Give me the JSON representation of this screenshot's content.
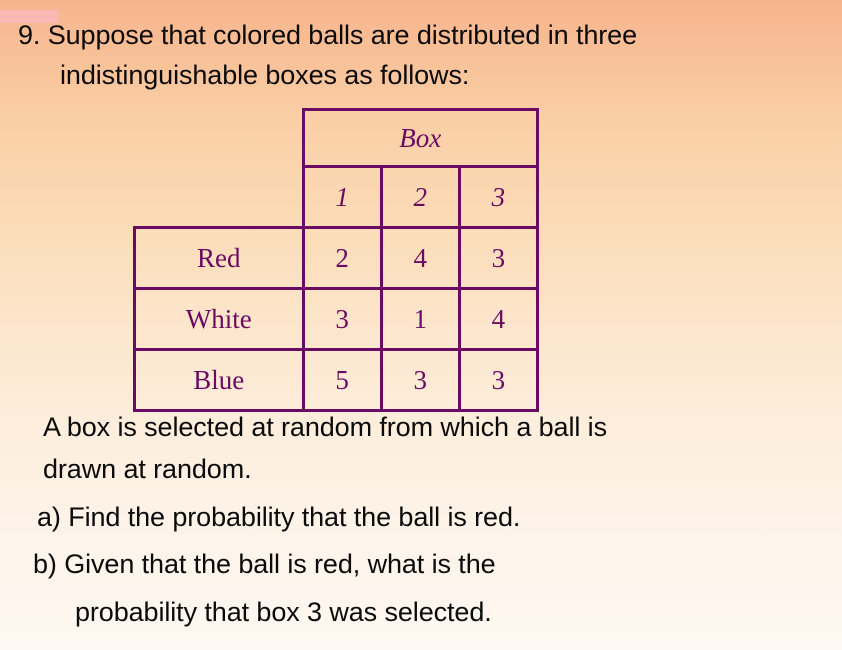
{
  "slide": {
    "background_top_color": "#F7B48C",
    "background_bottom_color": "#FEF8F2",
    "accent_color": "#6B0A62",
    "body_text_color": "#0B0B0B",
    "artifact_band_color": "#F9B8B4"
  },
  "question": {
    "line1": "9. Suppose that colored balls are distributed in three",
    "line2": "indistinguishable boxes as follows:"
  },
  "table": {
    "header_title": "Box",
    "column_headers": [
      "1",
      "2",
      "3"
    ],
    "row_labels": [
      "Red",
      "White",
      "Blue"
    ],
    "rows": [
      {
        "label": "Red",
        "values": [
          "2",
          "4",
          "3"
        ]
      },
      {
        "label": "White",
        "values": [
          "3",
          "1",
          "4"
        ]
      },
      {
        "label": "Blue",
        "values": [
          "5",
          "3",
          "3"
        ]
      }
    ]
  },
  "body": {
    "setup_line1": "A box is selected at random from which a ball is",
    "setup_line2": "drawn at random.",
    "part_a": "a) Find the probability that the ball is red.",
    "part_b_line1": "b) Given that the ball is red, what is the",
    "part_b_line2": "probability that box 3 was selected."
  }
}
